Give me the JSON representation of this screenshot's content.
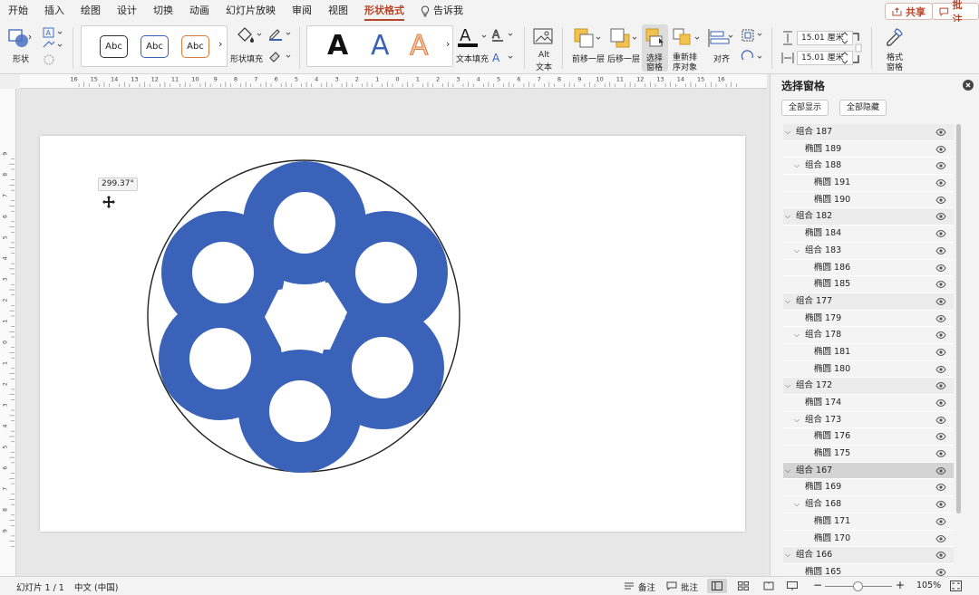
{
  "tabs": [
    "开始",
    "插入",
    "绘图",
    "设计",
    "切换",
    "动画",
    "幻灯片放映",
    "审阅",
    "视图",
    "形状格式"
  ],
  "tell_me": "告诉我",
  "share_label": "共享",
  "comments_label": "批注",
  "ribbon": {
    "shape_label": "形状",
    "style_previews": [
      "Abc",
      "Abc",
      "Abc"
    ],
    "shape_fill_label": "形状填充",
    "wordart_letters": [
      "A",
      "A",
      "A"
    ],
    "text_fill_label": "文本填充",
    "alt_text_line1": "Alt",
    "alt_text_line2": "文本",
    "bring_forward_label": "前移一层",
    "send_backward_label": "后移一层",
    "selection_pane_line1": "选择",
    "selection_pane_line2": "窗格",
    "reorder_line1": "重新排",
    "reorder_line2": "序对象",
    "align_label": "对齐",
    "height_value": "15.01 厘米",
    "width_value": "15.01 厘米",
    "format_pane_line1": "格式",
    "format_pane_line2": "窗格"
  },
  "ruler_labels": [
    "16",
    "15",
    "14",
    "13",
    "12",
    "11",
    "10",
    "9",
    "8",
    "7",
    "6",
    "5",
    "4",
    "3",
    "2",
    "1",
    "0",
    "1",
    "2",
    "3",
    "4",
    "5",
    "6",
    "7",
    "8",
    "9",
    "10",
    "11",
    "12",
    "13",
    "14",
    "15",
    "16"
  ],
  "vruler_labels": [
    "9",
    "8",
    "7",
    "6",
    "5",
    "4",
    "3",
    "2",
    "1",
    "0",
    "1",
    "2",
    "3",
    "4",
    "5",
    "6",
    "7",
    "8",
    "9"
  ],
  "rotation_tooltip": "299.37°",
  "colors": {
    "shape_blue": "#3a62b8",
    "accent": "#b7472a"
  },
  "selection_pane": {
    "title": "选择窗格",
    "show_all": "全部显示",
    "hide_all": "全部隐藏",
    "items": [
      {
        "label": "组合 187",
        "level": 0,
        "expanded": true
      },
      {
        "label": "椭圆 189",
        "level": 1
      },
      {
        "label": "组合 188",
        "level": 1,
        "expanded": true
      },
      {
        "label": "椭圆 191",
        "level": 2
      },
      {
        "label": "椭圆 190",
        "level": 2
      },
      {
        "label": "组合 182",
        "level": 0,
        "expanded": true
      },
      {
        "label": "椭圆 184",
        "level": 1
      },
      {
        "label": "组合 183",
        "level": 1,
        "expanded": true
      },
      {
        "label": "椭圆 186",
        "level": 2
      },
      {
        "label": "椭圆 185",
        "level": 2
      },
      {
        "label": "组合 177",
        "level": 0,
        "expanded": true
      },
      {
        "label": "椭圆 179",
        "level": 1
      },
      {
        "label": "组合 178",
        "level": 1,
        "expanded": true
      },
      {
        "label": "椭圆 181",
        "level": 2
      },
      {
        "label": "椭圆 180",
        "level": 2
      },
      {
        "label": "组合 172",
        "level": 0,
        "expanded": true
      },
      {
        "label": "椭圆 174",
        "level": 1
      },
      {
        "label": "组合 173",
        "level": 1,
        "expanded": true
      },
      {
        "label": "椭圆 176",
        "level": 2
      },
      {
        "label": "椭圆 175",
        "level": 2
      },
      {
        "label": "组合 167",
        "level": 0,
        "expanded": true,
        "selected": true
      },
      {
        "label": "椭圆 169",
        "level": 1
      },
      {
        "label": "组合 168",
        "level": 1,
        "expanded": true
      },
      {
        "label": "椭圆 171",
        "level": 2
      },
      {
        "label": "椭圆 170",
        "level": 2
      },
      {
        "label": "组合 166",
        "level": 0,
        "expanded": true
      },
      {
        "label": "椭圆 165",
        "level": 1
      }
    ]
  },
  "status": {
    "slide_count": "幻灯片 1 / 1",
    "language": "中文 (中国)",
    "notes": "备注",
    "comments": "批注",
    "zoom": "105%"
  }
}
